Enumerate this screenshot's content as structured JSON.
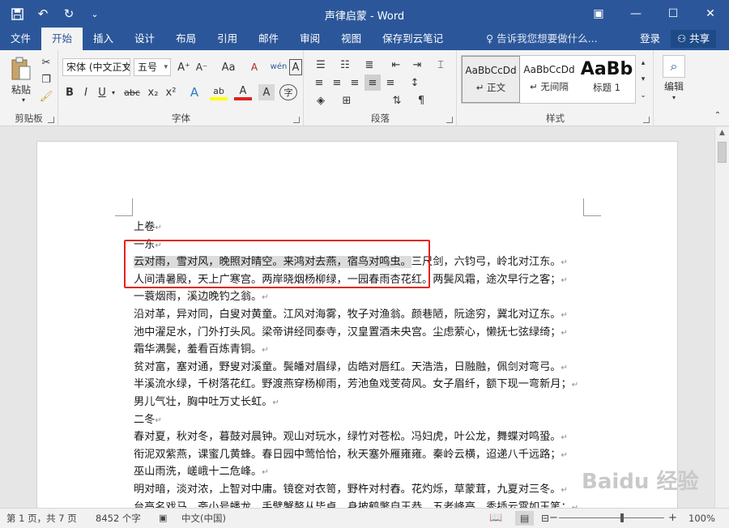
{
  "window": {
    "title": "声律启蒙 - Word",
    "qat": [
      {
        "name": "save-icon",
        "glyph": "💾"
      },
      {
        "name": "undo-icon",
        "glyph": "↶"
      },
      {
        "name": "redo-icon",
        "glyph": "↻"
      },
      {
        "name": "customize-qat-icon",
        "glyph": "⌄"
      }
    ],
    "controls": {
      "ribbon_options": "▣",
      "minimize": "—",
      "maximize": "☐",
      "close": "✕"
    }
  },
  "tabs": [
    "文件",
    "开始",
    "插入",
    "设计",
    "布局",
    "引用",
    "邮件",
    "审阅",
    "视图",
    "保存到云笔记"
  ],
  "active_tab": "开始",
  "tell_me": "♀ 告诉我您想要做什么...",
  "login": "登录",
  "share": "⚇ 共享",
  "ribbon": {
    "clipboard": {
      "label": "剪贴板",
      "paste": "粘贴"
    },
    "font": {
      "label": "字体",
      "font_name": "宋体 (中文正文)",
      "font_size": "五号",
      "buttons": {
        "bold": "B",
        "italic": "I",
        "underline": "U",
        "strike": "abc",
        "sub": "x₂",
        "sup": "x²",
        "grow": "A⁺",
        "shrink": "A⁻",
        "case": "Aa",
        "clear": "A",
        "phonetic": "wén",
        "border_char": "A",
        "effects": "A",
        "highlight": "ab",
        "color": "A",
        "shade": "A",
        "circle": "字"
      }
    },
    "paragraph": {
      "label": "段落"
    },
    "styles": {
      "label": "样式",
      "items": [
        {
          "sample": "AaBbCcDd",
          "name": "↵ 正文"
        },
        {
          "sample": "AaBbCcDd",
          "name": "↵ 无间隔"
        },
        {
          "sample": "AaBb",
          "name": "标题 1"
        }
      ]
    },
    "editing": {
      "label": "编辑"
    }
  },
  "document": {
    "paragraphs": [
      {
        "text": "上卷",
        "hl": false
      },
      {
        "text": "一东",
        "hl": false
      },
      {
        "text": "云对雨，雪对风，晚照对晴空。来鸿对去燕，宿鸟对鸣虫。",
        "hl": true,
        "tail": "三尺剑，六钧弓，岭北对江东。"
      },
      {
        "text": "人间清暑殿，天上广寒宫。两岸晓烟杨柳绿，一园春雨杏花红。两鬓风霜，途次早行之客；",
        "hl": false
      },
      {
        "text": "一蓑烟雨，溪边晚钓之翁。",
        "hl": false
      },
      {
        "text": "沿对革，异对同，白叟对黄童。江风对海雾，牧子对渔翁。颜巷陋，阮途穷，冀北对辽东。",
        "hl": false
      },
      {
        "text": "池中濯足水，门外打头风。梁帝讲经同泰寺，汉皇置酒未央宫。尘虑萦心，懒抚七弦绿绮；",
        "hl": false
      },
      {
        "text": "霜华满鬓，羞看百炼青铜。",
        "hl": false
      },
      {
        "text": "贫对富，塞对通，野叟对溪童。鬓皤对眉绿，齿皓对唇红。天浩浩，日融融，佩剑对弯弓。",
        "hl": false
      },
      {
        "text": "半溪流水绿，千树落花红。野渡燕穿杨柳雨，芳池鱼戏芰荷风。女子眉纤，额下现一弯新月；",
        "hl": false
      },
      {
        "text": "男儿气壮，胸中吐万丈长虹。",
        "hl": false
      },
      {
        "text": "二冬",
        "hl": false
      },
      {
        "text": "春对夏，秋对冬，暮鼓对晨钟。观山对玩水，绿竹对苍松。冯妇虎，叶公龙，舞蝶对鸣蛩。",
        "hl": false
      },
      {
        "text": "衔泥双紫燕，课蜜几黄蜂。春日园中莺恰恰，秋天塞外雁雍雍。秦岭云横，迢递八千远路；",
        "hl": false
      },
      {
        "text": "巫山雨洗，嵯峨十二危峰。",
        "hl": false
      },
      {
        "text": "明对暗，淡对浓，上智对中庸。镜奁对衣笥，野杵对村舂。花灼烁，草蒙茸，九夏对三冬。",
        "hl": false
      },
      {
        "text": "台高名戏马，斋小号蟠龙。手擘蟹螯从毕卓，身披鹤氅自王恭。五老峰高，秀插云霄如玉笔；",
        "hl": false
      }
    ]
  },
  "status": {
    "page": "第 1 页，共 7 页",
    "words": "8452 个字",
    "proof_icon": "▣",
    "language": "中文(中国)",
    "zoom": "100%",
    "zoom_minus": "−",
    "zoom_plus": "+"
  },
  "watermark": "Baidu 经验",
  "colors": {
    "brand": "#2b579a",
    "selection_box": "#e0221f"
  }
}
